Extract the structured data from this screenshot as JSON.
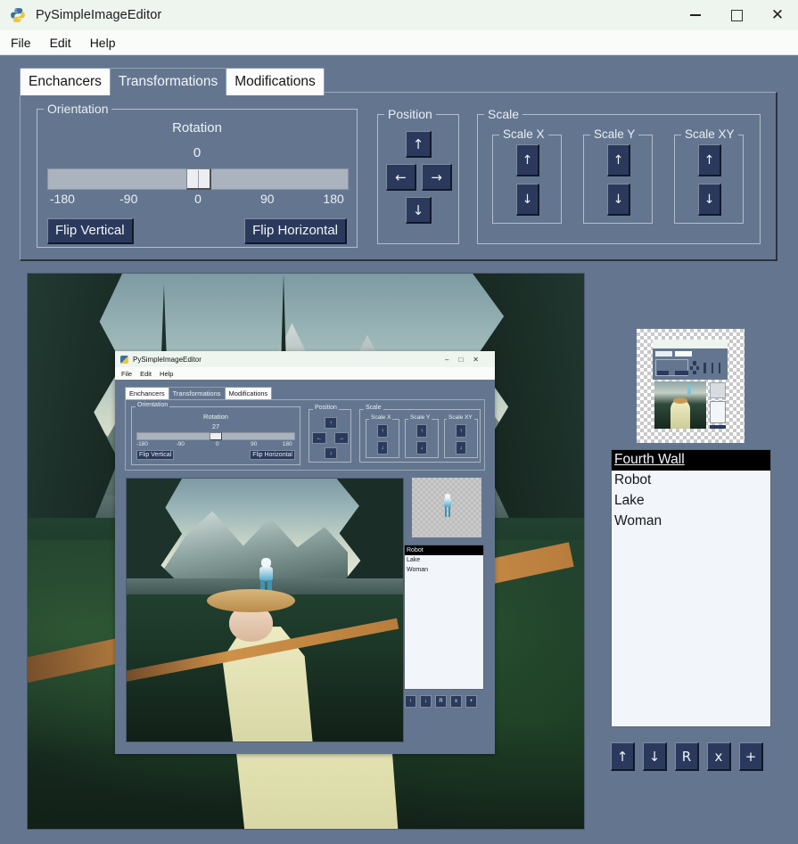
{
  "window": {
    "title": "PySimpleImageEditor",
    "controls": {
      "minimize": "—",
      "maximize": "□",
      "close": "✕"
    },
    "logo_icon": "python-logo-icon"
  },
  "menubar": {
    "items": [
      "File",
      "Edit",
      "Help"
    ]
  },
  "tabs": [
    {
      "label": "Enchancers",
      "active": false
    },
    {
      "label": "Transformations",
      "active": true
    },
    {
      "label": "Modifications",
      "active": false
    }
  ],
  "orientation": {
    "frame_label": "Orientation",
    "rotation_label": "Rotation",
    "rotation_value": "0",
    "slider": {
      "min": -180,
      "max": 180,
      "value": 0
    },
    "ticks": [
      "-180",
      "-90",
      "0",
      "90",
      "180"
    ],
    "flip_vertical": "Flip Vertical",
    "flip_horizontal": "Flip Horizontal"
  },
  "position": {
    "frame_label": "Position",
    "up": "↑",
    "down": "↓",
    "left": "←",
    "right": "→"
  },
  "scale": {
    "frame_label": "Scale",
    "groups": [
      {
        "label": "Scale X",
        "up": "↑",
        "down": "↓"
      },
      {
        "label": "Scale Y",
        "up": "↑",
        "down": "↓"
      },
      {
        "label": "Scale XY",
        "up": "↑",
        "down": "↓"
      }
    ]
  },
  "layers": {
    "items": [
      {
        "name": "Fourth Wall",
        "selected": true
      },
      {
        "name": "Robot",
        "selected": false
      },
      {
        "name": "Lake",
        "selected": false
      },
      {
        "name": "Woman",
        "selected": false
      }
    ],
    "buttons": [
      {
        "label": "↑",
        "name": "move-layer-up-button"
      },
      {
        "label": "↓",
        "name": "move-layer-down-button"
      },
      {
        "label": "R",
        "name": "rename-layer-button"
      },
      {
        "label": "x",
        "name": "delete-layer-button"
      },
      {
        "label": "+",
        "name": "add-layer-button"
      }
    ]
  },
  "nested": {
    "window_title": "PySimpleImageEditor",
    "menubar": [
      "File",
      "Edit",
      "Help"
    ],
    "tabs": [
      "Enchancers",
      "Transformations",
      "Modifications"
    ],
    "orientation_label": "Orientation",
    "rotation_label": "Rotation",
    "rotation_value": "27",
    "ticks": [
      "-180",
      "-90",
      "0",
      "90",
      "180"
    ],
    "flip_vertical": "Flip Vertical",
    "flip_horizontal": "Flip Horizontal",
    "position_label": "Position",
    "scale_label": "Scale",
    "scale_groups": [
      "Scale X",
      "Scale Y",
      "Scale XY"
    ],
    "layers": [
      {
        "name": "Robot",
        "selected": true
      },
      {
        "name": "Lake",
        "selected": false
      },
      {
        "name": "Woman",
        "selected": false
      }
    ],
    "layer_buttons": [
      "↑",
      "↓",
      "R",
      "x",
      "+"
    ]
  },
  "colors": {
    "window_bg": "#64768f",
    "titlebar_bg": "#eef5ef",
    "button_bg": "#2b3a5c",
    "slider_track": "#aab3be",
    "list_bg": "#f2f5f9",
    "selected_bg": "#000000"
  }
}
